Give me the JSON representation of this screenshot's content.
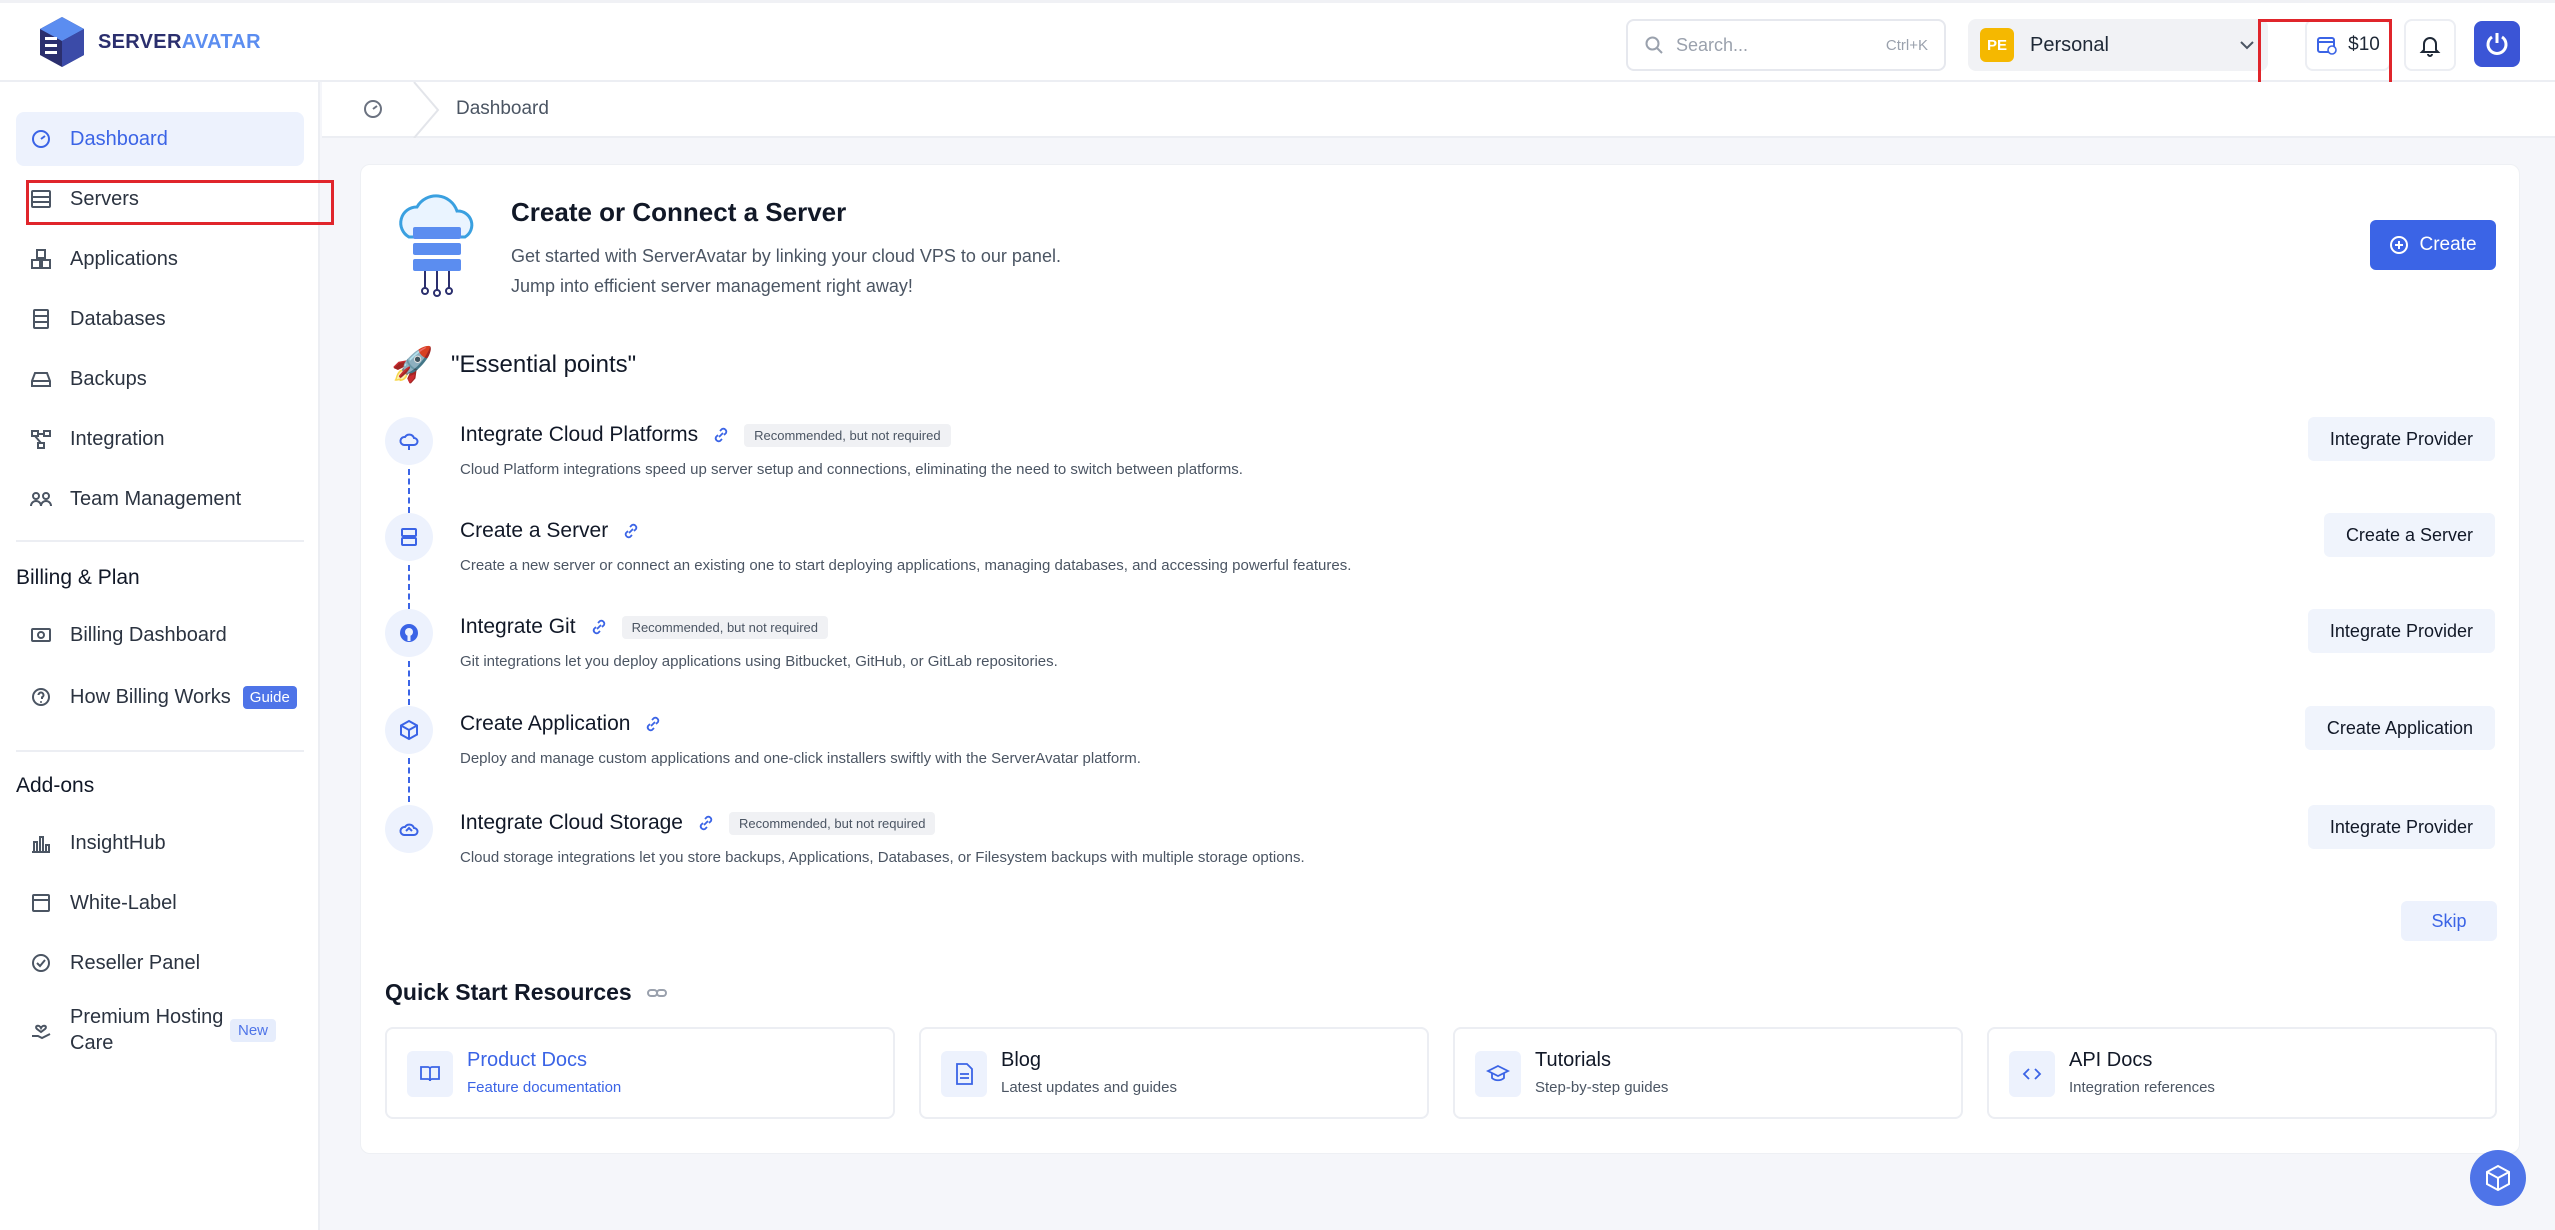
{
  "header": {
    "logo_text_a": "SERVER",
    "logo_text_b": "AVATAR",
    "search_placeholder": "Search...",
    "search_shortcut": "Ctrl+K",
    "workspace_badge": "PE",
    "workspace_name": "Personal",
    "credit_amount": "$10"
  },
  "sidebar": {
    "items": [
      {
        "label": "Dashboard"
      },
      {
        "label": "Servers"
      },
      {
        "label": "Applications"
      },
      {
        "label": "Databases"
      },
      {
        "label": "Backups"
      },
      {
        "label": "Integration"
      },
      {
        "label": "Team Management"
      }
    ],
    "billing_title": "Billing & Plan",
    "billing_items": [
      {
        "label": "Billing Dashboard"
      },
      {
        "label": "How Billing Works",
        "tag": "Guide"
      }
    ],
    "addons_title": "Add-ons",
    "addon_items": [
      {
        "label": "InsightHub"
      },
      {
        "label": "White-Label"
      },
      {
        "label": "Reseller Panel"
      },
      {
        "label": "Premium Hosting Care",
        "tag": "New"
      }
    ]
  },
  "breadcrumb": {
    "current": "Dashboard"
  },
  "hero": {
    "title": "Create or Connect a Server",
    "line1": "Get started with ServerAvatar by linking your cloud VPS to our panel.",
    "line2": "Jump into efficient server management right away!",
    "create_label": "Create"
  },
  "essentials": {
    "title": "\"Essential points\"",
    "steps": [
      {
        "title": "Integrate Cloud Platforms",
        "tag": "Recommended, but not required",
        "desc": "Cloud Platform integrations speed up server setup and connections, eliminating the need to switch between platforms.",
        "button": "Integrate Provider"
      },
      {
        "title": "Create a Server",
        "tag": "",
        "desc": "Create a new server or connect an existing one to start deploying applications, managing databases, and accessing powerful features.",
        "button": "Create a Server"
      },
      {
        "title": "Integrate Git",
        "tag": "Recommended, but not required",
        "desc": "Git integrations let you deploy applications using Bitbucket, GitHub, or GitLab repositories.",
        "button": "Integrate Provider"
      },
      {
        "title": "Create Application",
        "tag": "",
        "desc": "Deploy and manage custom applications and one-click installers swiftly with the ServerAvatar platform.",
        "button": "Create Application"
      },
      {
        "title": "Integrate Cloud Storage",
        "tag": "Recommended, but not required",
        "desc": "Cloud storage integrations let you store backups, Applications, Databases, or Filesystem backups with multiple storage options.",
        "button": "Integrate Provider"
      }
    ],
    "skip_label": "Skip"
  },
  "resources": {
    "title": "Quick Start Resources",
    "items": [
      {
        "title": "Product Docs",
        "desc": "Feature documentation",
        "icon": "book-icon"
      },
      {
        "title": "Blog",
        "desc": "Latest updates and guides",
        "icon": "document-icon"
      },
      {
        "title": "Tutorials",
        "desc": "Step-by-step guides",
        "icon": "graduation-cap-icon"
      },
      {
        "title": "API Docs",
        "desc": "Integration references",
        "icon": "code-icon"
      }
    ]
  },
  "colors": {
    "accent": "#3b64e6",
    "highlight": "#e0252b",
    "workspace_badge": "#f5b800"
  }
}
